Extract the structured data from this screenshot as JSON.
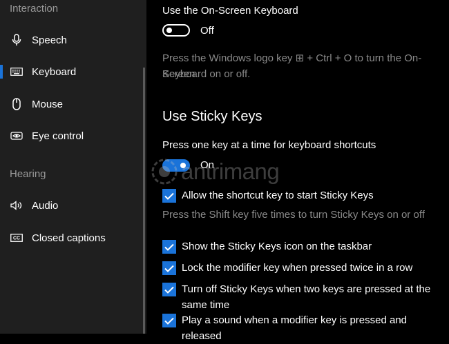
{
  "sidebar": {
    "section_interaction": "Interaction",
    "section_hearing": "Hearing",
    "items": [
      {
        "label": "Speech",
        "icon": "microphone-icon"
      },
      {
        "label": "Keyboard",
        "icon": "keyboard-icon",
        "selected": true
      },
      {
        "label": "Mouse",
        "icon": "mouse-icon"
      },
      {
        "label": "Eye control",
        "icon": "eye-icon"
      },
      {
        "label": "Audio",
        "icon": "speaker-icon"
      },
      {
        "label": "Closed captions",
        "icon": "captions-icon"
      }
    ]
  },
  "onscreen": {
    "label": "Use the On-Screen Keyboard",
    "state": "Off",
    "desc_line1": "Press the Windows logo key ⊞ + Ctrl + O to turn the On-Screen",
    "desc_line2": "Keyboard on or off."
  },
  "sticky": {
    "heading": "Use Sticky Keys",
    "label": "Press one key at a time for keyboard shortcuts",
    "state": "On",
    "shortcut_check": "Allow the shortcut key to start Sticky Keys",
    "shortcut_desc": "Press the Shift key five times to turn Sticky Keys on or off",
    "options": [
      "Show the Sticky Keys icon on the taskbar",
      "Lock the modifier key when pressed twice in a row",
      "Turn off Sticky Keys when two keys are pressed at the same time",
      "Play a sound when a modifier key is pressed and released"
    ]
  },
  "watermark": {
    "text": "antrimang"
  },
  "colors": {
    "accent": "#1a73d9",
    "sidebar_bg": "#1f1f1f",
    "content_bg": "#000000",
    "muted_text": "#8a8a8a"
  }
}
